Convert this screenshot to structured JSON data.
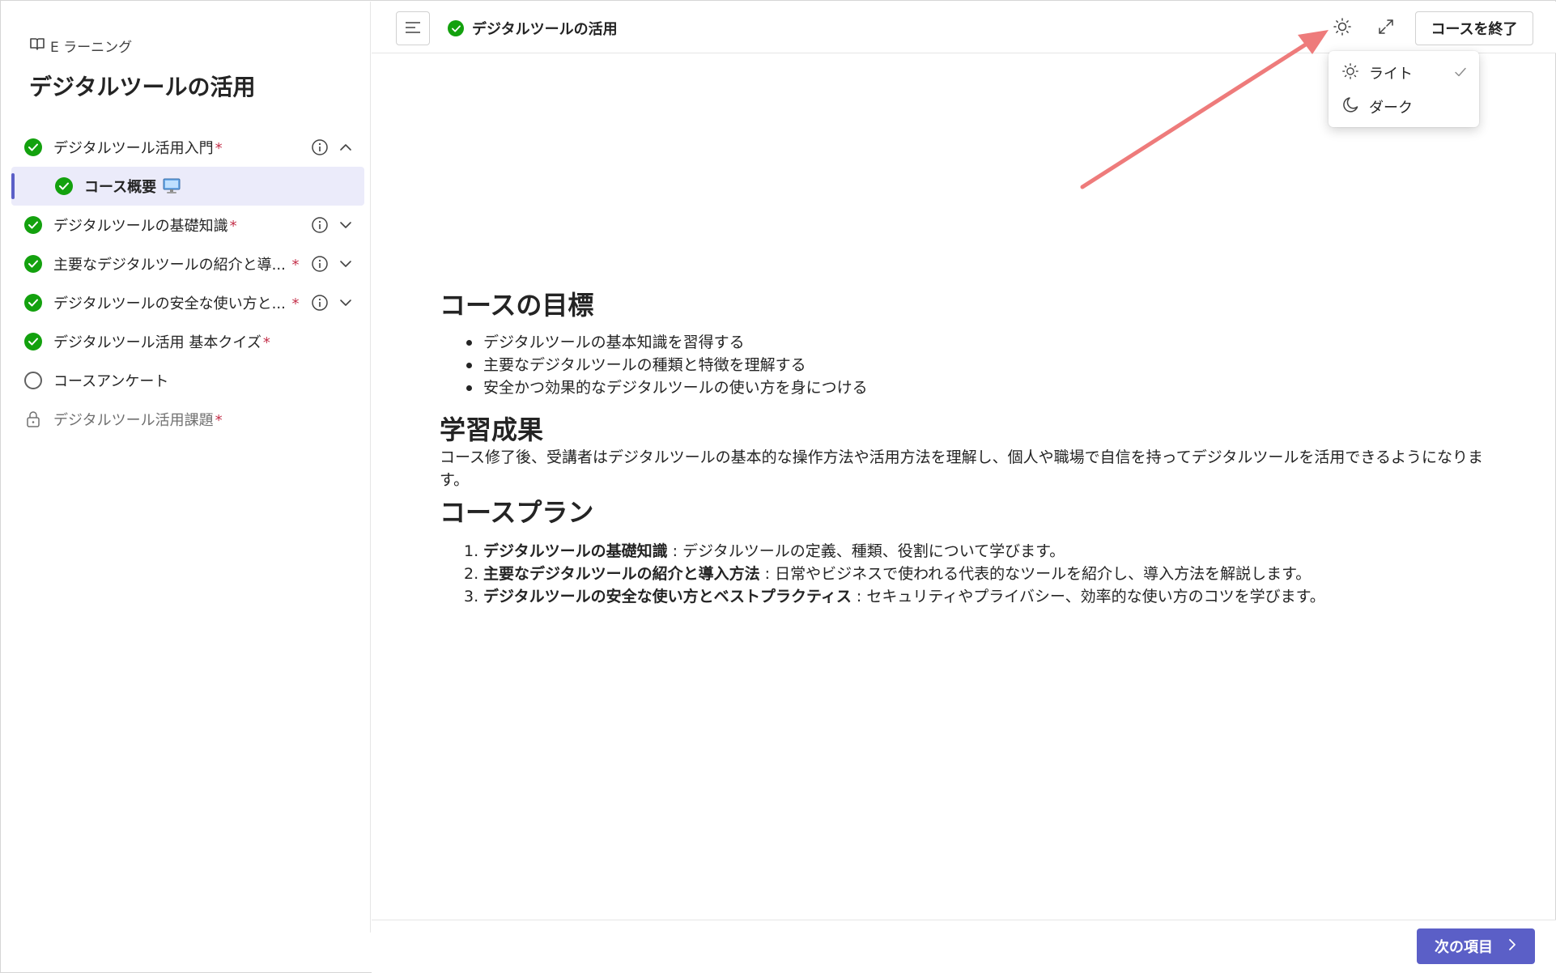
{
  "brand": {
    "label": "E ラーニング",
    "icon": "book-open-icon"
  },
  "course": {
    "title": "デジタルツールの活用"
  },
  "sidebar": {
    "items": [
      {
        "label": "デジタルツール活用入門",
        "required": "*",
        "status": "complete",
        "info": true,
        "chevron": "up"
      },
      {
        "label": "コース概要",
        "status": "complete",
        "sub": true,
        "badge_icon": "monitor-icon"
      },
      {
        "label": "デジタルツールの基礎知識",
        "required": "*",
        "status": "complete",
        "info": true,
        "chevron": "down"
      },
      {
        "label": "主要なデジタルツールの紹介と導...",
        "required": " *",
        "status": "complete",
        "info": true,
        "chevron": "down"
      },
      {
        "label": "デジタルツールの安全な使い方と...",
        "required": " *",
        "status": "complete",
        "info": true,
        "chevron": "down"
      },
      {
        "label": "デジタルツール活用 基本クイズ",
        "required": "*",
        "status": "complete"
      },
      {
        "label": "コースアンケート",
        "status": "incomplete"
      },
      {
        "label": "デジタルツール活用課題",
        "required": "*",
        "status": "locked"
      }
    ]
  },
  "topbar": {
    "breadcrumb": "デジタルツールの活用",
    "finish_label": "コースを終了"
  },
  "theme_menu": {
    "items": [
      {
        "label": "ライト",
        "icon": "sun-icon",
        "selected": true
      },
      {
        "label": "ダーク",
        "icon": "moon-icon",
        "selected": false
      }
    ]
  },
  "main": {
    "goals_heading": "コースの目標",
    "goals": [
      "デジタルツールの基本知識を習得する",
      "主要なデジタルツールの種類と特徴を理解する",
      " 安全かつ効果的なデジタルツールの使い方を身につける"
    ],
    "outcome_heading": "学習成果",
    "outcome_text": "コース修了後、受講者はデジタルツールの基本的な操作方法や活用方法を理解し、個人や職場で自信を持ってデジタルツールを活用できるようになります。",
    "plan_heading": "コースプラン",
    "plan": [
      {
        "num": "1.",
        "title": "デジタルツールの基礎知識",
        "desc": " : デジタルツールの定義、種類、役割について学びます。"
      },
      {
        "num": "2.",
        "title": "主要なデジタルツールの紹介と導入方法",
        "desc": " : 日常やビジネスで使われる代表的なツールを紹介し、導入方法を解説します。"
      },
      {
        "num": "3.",
        "title": " デジタルツールの安全な使い方とベストプラクティス",
        "desc": " : セキュリティやプライバシー、効率的な使い方のコツを学びます。"
      }
    ]
  },
  "footer": {
    "next_label": "次の項目"
  },
  "colors": {
    "accent": "#5b5fc7",
    "complete": "#13a10e",
    "required": "#c4314b",
    "annotation": "#ee7b7b"
  }
}
